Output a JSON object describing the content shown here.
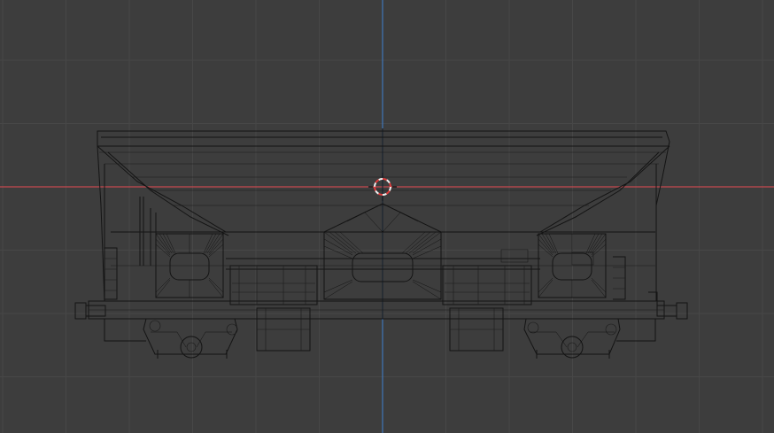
{
  "viewport": {
    "view": "front-orthographic",
    "shading": "wireframe",
    "grid": true,
    "x_axis_visible": true,
    "z_axis_visible": true,
    "cursor_visible": true
  },
  "colors": {
    "background": "#3d3d3d",
    "grid_line": "#474747",
    "x_axis": "#c54a4f",
    "z_axis": "#3f76b8",
    "wire": "#141414",
    "cursor_red": "#e03b3b",
    "cursor_white": "#f0f0f0"
  },
  "model": {
    "name": "hopper-wagon",
    "bogie_count": 2,
    "hopper_chute_count": 3,
    "axle_count": 4
  }
}
